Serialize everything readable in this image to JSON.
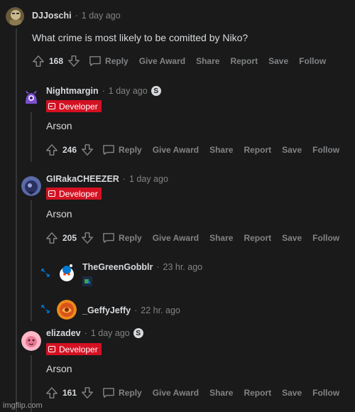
{
  "comments": [
    {
      "username": "DJJoschi",
      "time": "1 day ago",
      "text": "What crime is most likely to be comitted by Niko?",
      "score": "168"
    },
    {
      "username": "Nightmargin",
      "time": "1 day ago",
      "flair": "Developer",
      "text": "Arson",
      "score": "246"
    },
    {
      "username": "GIRakaCHEEZER",
      "time": "1 day ago",
      "flair": "Developer",
      "text": "Arson",
      "score": "205"
    },
    {
      "username": "TheGreenGobblr",
      "time": "23 hr. ago"
    },
    {
      "username": "_GeffyJeffy",
      "time": "22 hr. ago"
    },
    {
      "username": "elizadev",
      "time": "1 day ago",
      "flair": "Developer",
      "text": "Arson",
      "score": "161"
    }
  ],
  "actions": {
    "reply": "Reply",
    "give_award": "Give Award",
    "share": "Share",
    "report": "Report",
    "save": "Save",
    "follow": "Follow"
  },
  "separator": "·",
  "badge_letter": "S",
  "watermark": "imgflip.com",
  "colors": {
    "background": "#1a1a1b",
    "text": "#d7dadc",
    "muted": "#818384",
    "flair": "#d41122",
    "thread_line": "#343536",
    "expand": "#0079d3"
  },
  "icons": {
    "upvote": "upvote-icon",
    "downvote": "downvote-icon",
    "comment": "comment-icon",
    "expand": "expand-icon",
    "badge": "s-badge-icon"
  }
}
